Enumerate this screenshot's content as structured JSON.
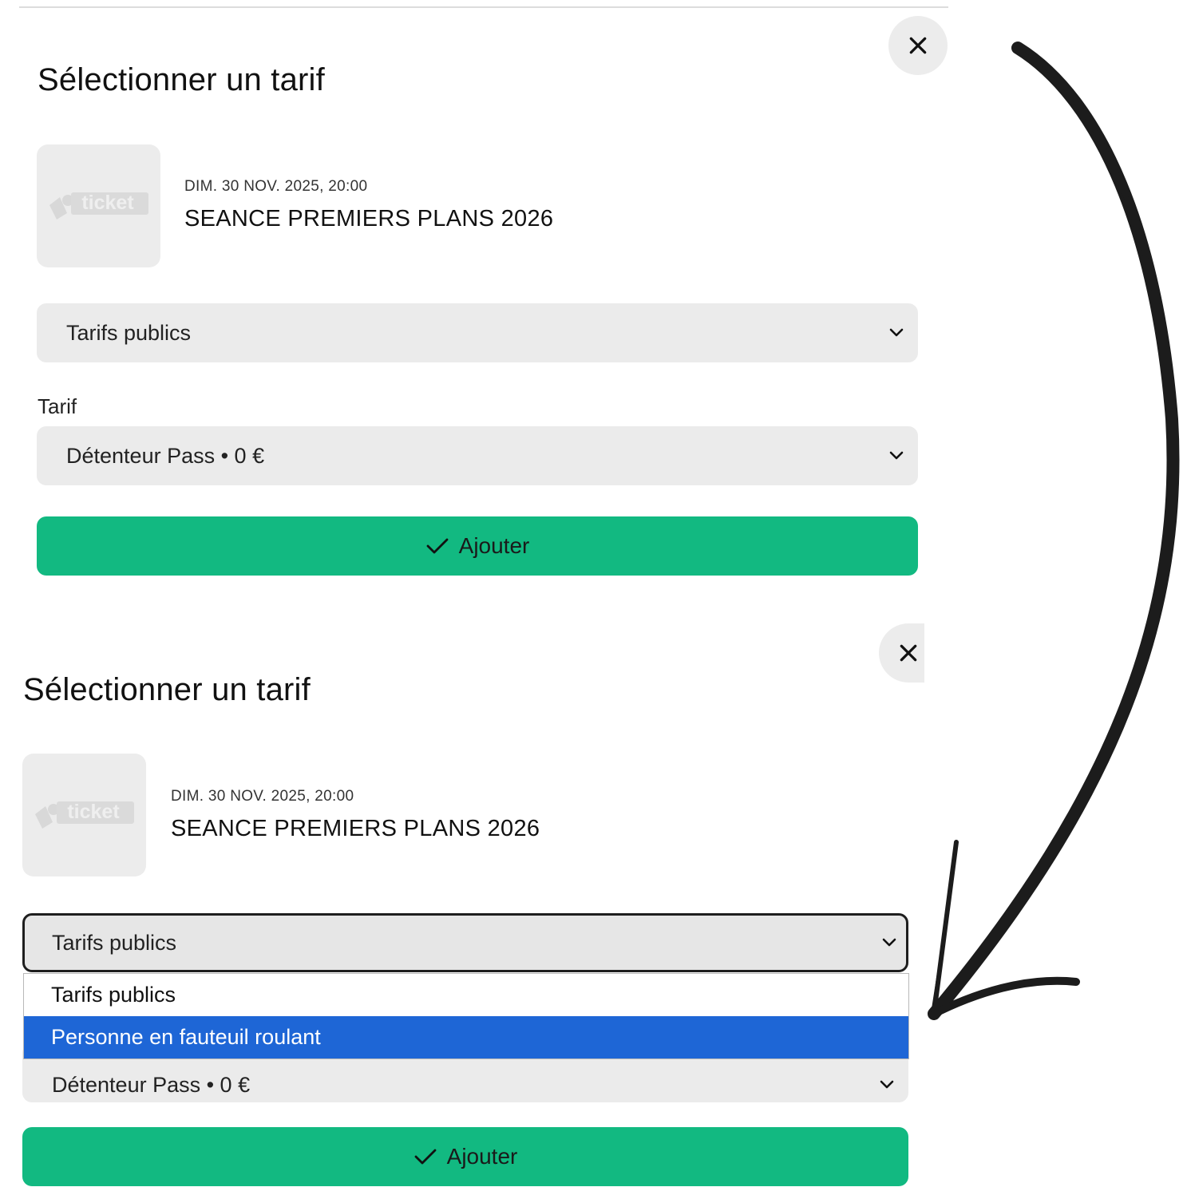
{
  "modal_top": {
    "title": "Sélectionner un tarif",
    "event": {
      "date": "DIM. 30 NOV. 2025, 20:00",
      "name": "SEANCE PREMIERS PLANS 2026"
    },
    "category_select": {
      "value": "Tarifs publics"
    },
    "tarif_label": "Tarif",
    "tarif_select": {
      "value": "Détenteur Pass • 0 €"
    },
    "add_button": "Ajouter"
  },
  "modal_bottom": {
    "title": "Sélectionner un tarif",
    "event": {
      "date": "DIM. 30 NOV. 2025, 20:00",
      "name": "SEANCE PREMIERS PLANS 2026"
    },
    "category_select": {
      "value": "Tarifs publics"
    },
    "dropdown_options": [
      "Tarifs publics",
      "Personne en fauteuil roulant"
    ],
    "highlighted_option": "Personne en fauteuil roulant",
    "tarif_select": {
      "value": "Détenteur Pass • 0 €"
    },
    "add_button": "Ajouter"
  },
  "logo_text": "ticket",
  "colors": {
    "accent_green": "#12b981",
    "highlight_blue": "#1e66d6",
    "field_bg": "#ebebeb"
  }
}
